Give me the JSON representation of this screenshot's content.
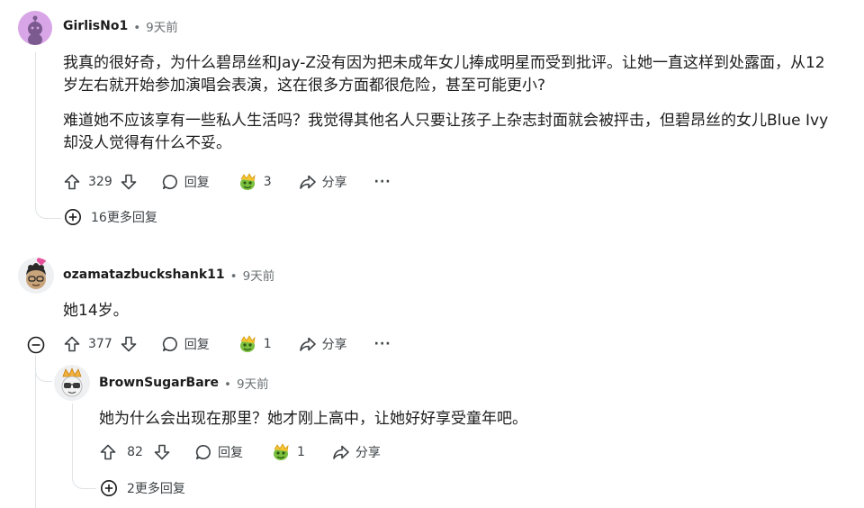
{
  "comments": [
    {
      "author": "GirlisNo1",
      "time": "9天前",
      "paragraphs": [
        "我真的很好奇，为什么碧昂丝和Jay-Z没有因为把未成年女儿捧成明星而受到批评。让她一直这样到处露面，从12岁左右就开始参加演唱会表演，这在很多方面都很危险，甚至可能更小?",
        "难道她不应该享有一些私人生活吗？我觉得其他名人只要让孩子上杂志封面就会被抨击，但碧昂丝的女儿Blue Ivy却没人觉得有什么不妥。"
      ],
      "votes": "329",
      "reply_label": "回复",
      "award_count": "3",
      "share_label": "分享",
      "more_label": "···",
      "more_replies": "16更多回复"
    },
    {
      "author": "ozamatazbuckshank11",
      "time": "9天前",
      "paragraphs": [
        "她14岁。"
      ],
      "votes": "377",
      "reply_label": "回复",
      "award_count": "1",
      "share_label": "分享",
      "more_label": "···"
    },
    {
      "author": "BrownSugarBare",
      "time": "9天前",
      "paragraphs": [
        "她为什么会出现在那里？她才刚上高中，让她好好享受童年吧。"
      ],
      "votes": "82",
      "reply_label": "回复",
      "award_count": "1",
      "share_label": "分享",
      "more_replies": "2更多回复"
    }
  ],
  "meta_separator": "•",
  "colors": {
    "text": "#1c1c1c",
    "meta": "#6a7073",
    "thread_line": "#dfe3e6",
    "avatar1_bg": "#d8a6e6",
    "avatar1_fg": "#7b5a8f"
  }
}
